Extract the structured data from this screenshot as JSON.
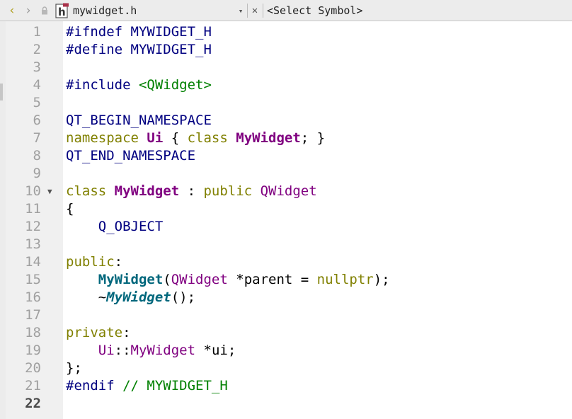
{
  "toolbar": {
    "back_icon": "chevron-left-icon",
    "forward_icon": "chevron-right-icon",
    "lock_icon": "lock-icon",
    "file_icon": "header-file-icon",
    "file_icon_letter": "h",
    "file_name": "mywidget.h",
    "dropdown_icon": "triangle-down-icon",
    "close_icon": "close-icon",
    "symbol_selector": "<Select Symbol>"
  },
  "editor": {
    "current_line": 22,
    "colors": {
      "keyword": "#808000",
      "class_name": "#800080",
      "function": "#00677c",
      "preprocessor": "#000080",
      "string": "#008000",
      "comment": "#008000"
    },
    "lines": [
      {
        "number": "1",
        "tokens": [
          {
            "t": "#ifndef MYWIDGET_H",
            "c": "pp"
          }
        ]
      },
      {
        "number": "2",
        "tokens": [
          {
            "t": "#define MYWIDGET_H",
            "c": "pp"
          }
        ]
      },
      {
        "number": "3",
        "tokens": []
      },
      {
        "number": "4",
        "tokens": [
          {
            "t": "#include ",
            "c": "pp"
          },
          {
            "t": "<QWidget>",
            "c": "str"
          }
        ]
      },
      {
        "number": "5",
        "tokens": []
      },
      {
        "number": "6",
        "tokens": [
          {
            "t": "QT_BEGIN_NAMESPACE",
            "c": "mac"
          }
        ]
      },
      {
        "number": "7",
        "tokens": [
          {
            "t": "namespace ",
            "c": "kw"
          },
          {
            "t": "Ui",
            "c": "cls"
          },
          {
            "t": " { ",
            "c": "plain"
          },
          {
            "t": "class ",
            "c": "kw"
          },
          {
            "t": "MyWidget",
            "c": "cls"
          },
          {
            "t": "; }",
            "c": "plain"
          }
        ]
      },
      {
        "number": "8",
        "tokens": [
          {
            "t": "QT_END_NAMESPACE",
            "c": "mac"
          }
        ]
      },
      {
        "number": "9",
        "tokens": []
      },
      {
        "number": "10",
        "fold": true,
        "tokens": [
          {
            "t": "class ",
            "c": "kw"
          },
          {
            "t": "MyWidget",
            "c": "cls"
          },
          {
            "t": " : ",
            "c": "plain"
          },
          {
            "t": "public ",
            "c": "kw"
          },
          {
            "t": "QWidget",
            "c": "ty"
          }
        ]
      },
      {
        "number": "11",
        "tokens": [
          {
            "t": "{",
            "c": "plain"
          }
        ]
      },
      {
        "number": "12",
        "tokens": [
          {
            "t": "    Q_OBJECT",
            "c": "mac"
          }
        ]
      },
      {
        "number": "13",
        "tokens": []
      },
      {
        "number": "14",
        "tokens": [
          {
            "t": "public",
            "c": "kw"
          },
          {
            "t": ":",
            "c": "plain"
          }
        ]
      },
      {
        "number": "15",
        "tokens": [
          {
            "t": "    ",
            "c": "plain"
          },
          {
            "t": "MyWidget",
            "c": "fn"
          },
          {
            "t": "(",
            "c": "plain"
          },
          {
            "t": "QWidget",
            "c": "ty"
          },
          {
            "t": " *parent = ",
            "c": "plain"
          },
          {
            "t": "nullptr",
            "c": "kw"
          },
          {
            "t": ");",
            "c": "plain"
          }
        ]
      },
      {
        "number": "16",
        "tokens": [
          {
            "t": "    ~",
            "c": "plain"
          },
          {
            "t": "MyWidget",
            "c": "dtor"
          },
          {
            "t": "();",
            "c": "plain"
          }
        ]
      },
      {
        "number": "17",
        "tokens": []
      },
      {
        "number": "18",
        "tokens": [
          {
            "t": "private",
            "c": "kw"
          },
          {
            "t": ":",
            "c": "plain"
          }
        ]
      },
      {
        "number": "19",
        "tokens": [
          {
            "t": "    ",
            "c": "plain"
          },
          {
            "t": "Ui",
            "c": "ty"
          },
          {
            "t": "::",
            "c": "plain"
          },
          {
            "t": "MyWidget",
            "c": "ty"
          },
          {
            "t": " *ui;",
            "c": "plain"
          }
        ]
      },
      {
        "number": "20",
        "tokens": [
          {
            "t": "};",
            "c": "plain"
          }
        ]
      },
      {
        "number": "21",
        "tokens": [
          {
            "t": "#endif ",
            "c": "pp"
          },
          {
            "t": "// MYWIDGET_H",
            "c": "cmt"
          }
        ]
      },
      {
        "number": "22",
        "tokens": []
      }
    ]
  }
}
